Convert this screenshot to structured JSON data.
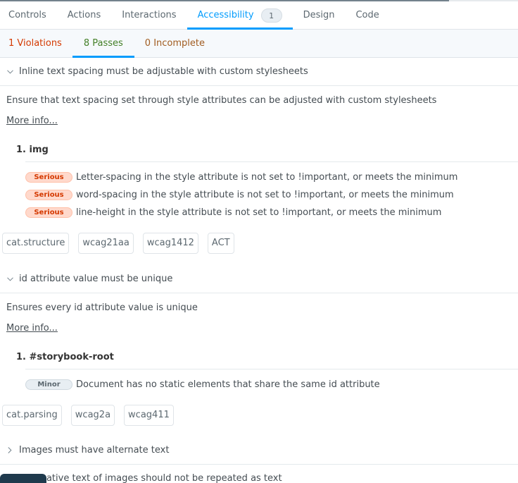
{
  "tabs": [
    {
      "label": "Controls"
    },
    {
      "label": "Actions"
    },
    {
      "label": "Interactions"
    },
    {
      "label": "Accessibility",
      "count": "1",
      "active": true
    },
    {
      "label": "Design"
    },
    {
      "label": "Code"
    }
  ],
  "subtabs": {
    "violations": "1 Violations",
    "passes": "8 Passes",
    "incomplete": "0 Incomplete",
    "active": "passes"
  },
  "colors": {
    "accent": "#029cfd",
    "violations": "#d43900",
    "passes": "#448028",
    "incomplete": "#a15c20"
  },
  "rules": [
    {
      "title": "Inline text spacing must be adjustable with custom stylesheets",
      "expanded": true,
      "chevron": "chevron-down-icon",
      "description": "Ensure that text spacing set through style attributes can be adjusted with custom stylesheets",
      "more_info": "More info...",
      "node": "1. img",
      "checks": [
        {
          "impact": "Serious",
          "text": "Letter-spacing in the style attribute is not set to !important, or meets the minimum"
        },
        {
          "impact": "Serious",
          "text": "word-spacing in the style attribute is not set to !important, or meets the minimum"
        },
        {
          "impact": "Serious",
          "text": "line-height in the style attribute is not set to !important, or meets the minimum"
        }
      ],
      "tags": [
        "cat.structure",
        "wcag21aa",
        "wcag1412",
        "ACT"
      ]
    },
    {
      "title": "id attribute value must be unique",
      "expanded": true,
      "chevron": "chevron-down-icon",
      "description": "Ensures every id attribute value is unique",
      "more_info": "More info...",
      "node": "1. #storybook-root",
      "checks": [
        {
          "impact": "Minor",
          "text": "Document has no static elements that share the same id attribute"
        }
      ],
      "tags": [
        "cat.parsing",
        "wcag2a",
        "wcag411"
      ]
    },
    {
      "title": "Images must have alternate text",
      "expanded": false,
      "chevron": "chevron-right-icon"
    },
    {
      "title": "Alternative text of images should not be repeated as text",
      "expanded": false,
      "chevron": "chevron-right-icon"
    }
  ]
}
